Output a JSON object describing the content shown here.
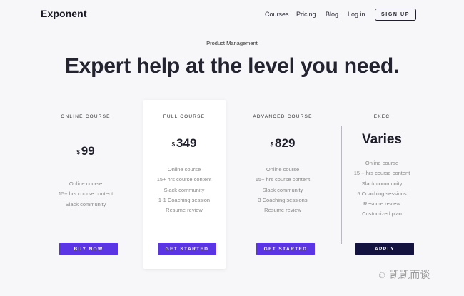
{
  "header": {
    "logo": "Exponent",
    "nav": [
      "Courses",
      "Pricing",
      "Blog",
      "Log in"
    ],
    "signup": "SIGN UP"
  },
  "hero": {
    "eyebrow": "Product Management",
    "title": "Expert help at the level you need."
  },
  "plans": [
    {
      "name": "ONLINE COURSE",
      "currency": "$",
      "price": "99",
      "features": [
        "Online course",
        "15+ hrs course content",
        "Slack community"
      ],
      "cta": "BUY NOW"
    },
    {
      "name": "FULL COURSE",
      "currency": "$",
      "price": "349",
      "features": [
        "Online course",
        "15+ hrs course content",
        "Slack community",
        "1-1 Coaching session",
        "Resume review"
      ],
      "cta": "GET STARTED"
    },
    {
      "name": "ADVANCED COURSE",
      "currency": "$",
      "price": "829",
      "features": [
        "Online course",
        "15+ hrs course content",
        "Slack community",
        "3 Coaching sessions",
        "Resume review"
      ],
      "cta": "GET STARTED"
    },
    {
      "name": "EXEC",
      "price_text": "Varies",
      "features": [
        "Online course",
        "15 + hrs course content",
        "Slack community",
        "5 Coaching sessions",
        "Resume review",
        "Customized plan"
      ],
      "cta": "APPLY"
    }
  ],
  "colors": {
    "accent": "#5b35e3",
    "dark_cta": "#14123e",
    "background": "#f7f7f9"
  },
  "watermark": "凯凯而谈"
}
